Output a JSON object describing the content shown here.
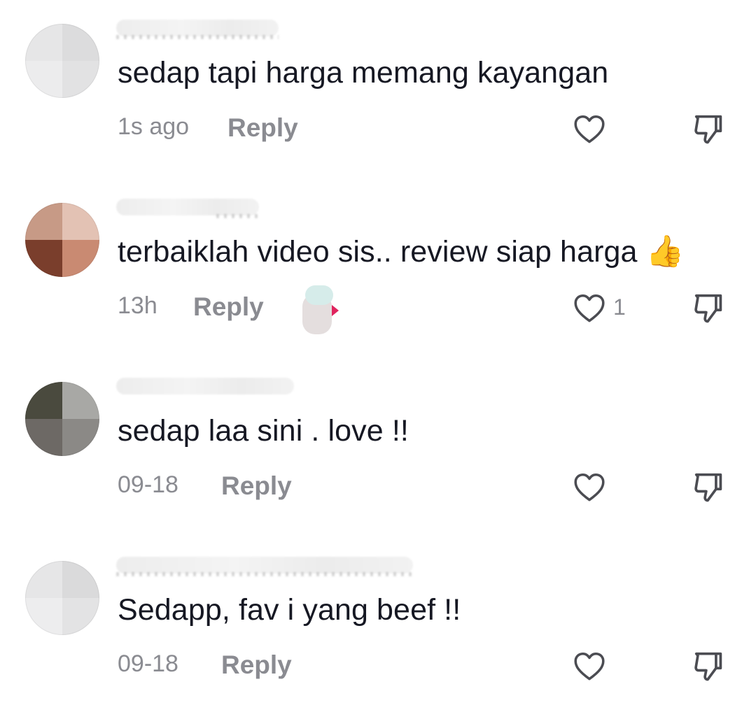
{
  "comments": [
    {
      "text": "sedap tapi harga memang kayangan",
      "time": "1s ago",
      "reply_label": "Reply",
      "likes": "",
      "avatar_colors": [
        "#e6e6e7",
        "#dcdcdd",
        "#ececed",
        "#e2e2e3"
      ]
    },
    {
      "text": "terbaiklah video sis.. review siap harga",
      "emoji": "👍",
      "time": "13h",
      "reply_label": "Reply",
      "likes": "1",
      "avatar_colors": [
        "#c79a86",
        "#e3c2b4",
        "#7a3e2c",
        "#c98a72"
      ]
    },
    {
      "text": "sedap laa sini . love !!",
      "time": "09-18",
      "reply_label": "Reply",
      "likes": "",
      "avatar_colors": [
        "#4a4a3e",
        "#a8a8a5",
        "#6d6965",
        "#8b8986"
      ]
    },
    {
      "text": "Sedapp, fav i yang beef !!",
      "time": "09-18",
      "reply_label": "Reply",
      "likes": "",
      "avatar_colors": [
        "#e6e6e7",
        "#dadadb",
        "#ededee",
        "#e3e3e4"
      ]
    }
  ],
  "colors": {
    "text": "#161823",
    "secondary": "#8a8b91"
  },
  "icons": {
    "like": "heart-outline-icon",
    "dislike": "thumbs-down-outline-icon"
  }
}
